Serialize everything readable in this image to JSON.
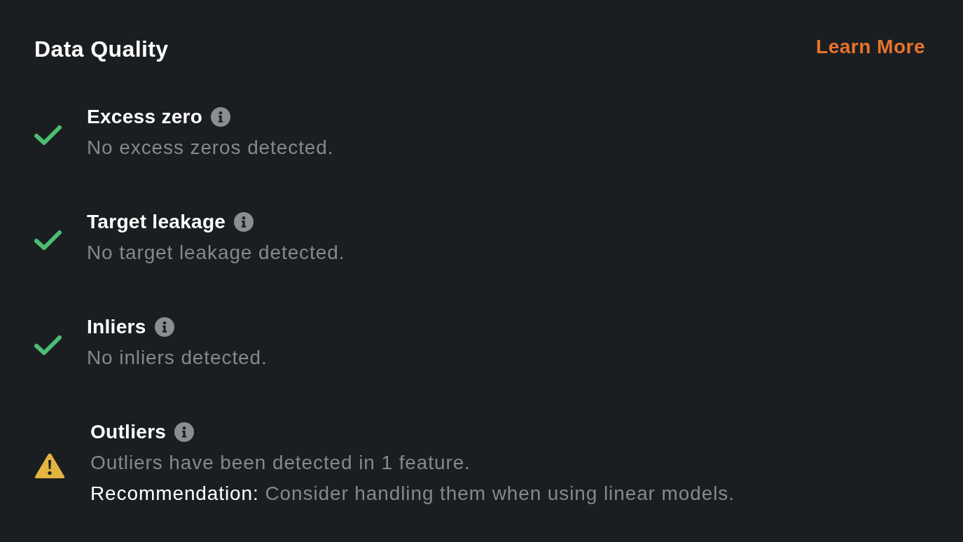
{
  "header": {
    "title": "Data Quality",
    "link": "Learn More"
  },
  "checks": [
    {
      "kind": "check",
      "title": "Excess zero",
      "description": "No excess zeros detected."
    },
    {
      "kind": "check",
      "title": "Target leakage",
      "description": "No target leakage detected."
    },
    {
      "kind": "check",
      "title": "Inliers",
      "description": "No inliers detected."
    },
    {
      "kind": "warning",
      "title": "Outliers",
      "description": "Outliers have been detected in 1 feature.",
      "recommendation": {
        "label": "Recommendation:",
        "text": "Consider handling them when using linear models."
      }
    }
  ]
}
